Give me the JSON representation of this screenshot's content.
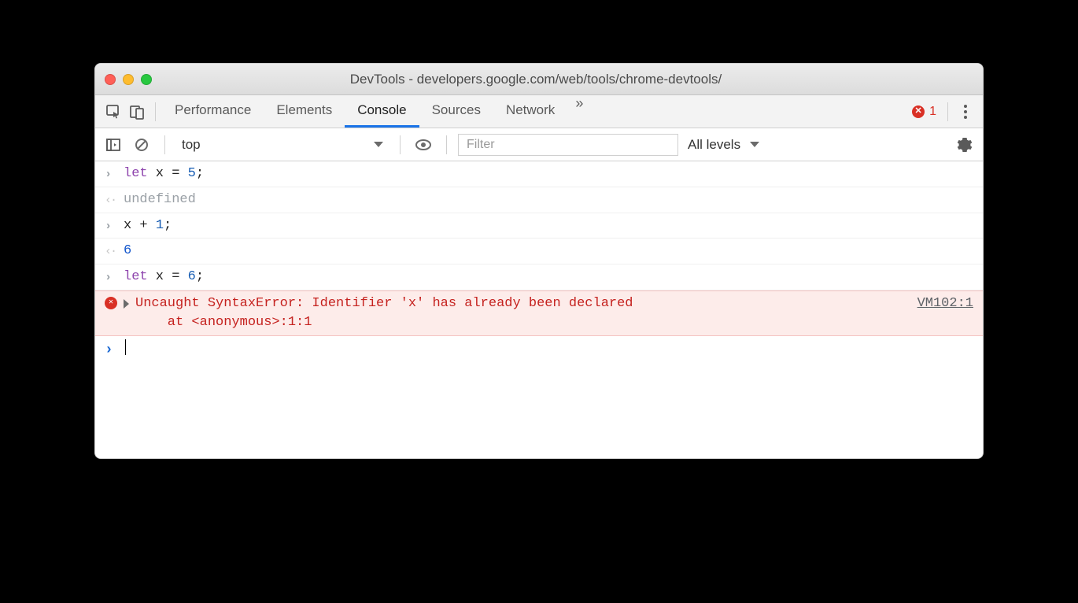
{
  "window": {
    "title": "DevTools - developers.google.com/web/tools/chrome-devtools/"
  },
  "tabs": {
    "items": [
      "Performance",
      "Elements",
      "Console",
      "Sources",
      "Network"
    ],
    "active_index": 2,
    "overflow": "»",
    "error_count": "1"
  },
  "filterbar": {
    "context": "top",
    "filter_placeholder": "Filter",
    "levels_label": "All levels"
  },
  "console": {
    "lines": [
      {
        "type": "input",
        "tokens": [
          [
            "kw",
            "let"
          ],
          [
            "txt",
            " x "
          ],
          [
            "txt",
            "="
          ],
          [
            "txt",
            " "
          ],
          [
            "n",
            "5"
          ],
          [
            "txt",
            ";"
          ]
        ]
      },
      {
        "type": "output",
        "text": "undefined",
        "cls": "muted"
      },
      {
        "type": "input",
        "tokens": [
          [
            "txt",
            "x "
          ],
          [
            "txt",
            "+"
          ],
          [
            "txt",
            " "
          ],
          [
            "n",
            "1"
          ],
          [
            "txt",
            ";"
          ]
        ]
      },
      {
        "type": "output",
        "text": "6",
        "cls": "v"
      },
      {
        "type": "input",
        "tokens": [
          [
            "kw",
            "let"
          ],
          [
            "txt",
            " x "
          ],
          [
            "txt",
            "="
          ],
          [
            "txt",
            " "
          ],
          [
            "n",
            "6"
          ],
          [
            "txt",
            ";"
          ]
        ]
      }
    ],
    "error": {
      "message": "Uncaught SyntaxError: Identifier 'x' has already been declared\n    at <anonymous>:1:1",
      "source": "VM102:1"
    }
  }
}
